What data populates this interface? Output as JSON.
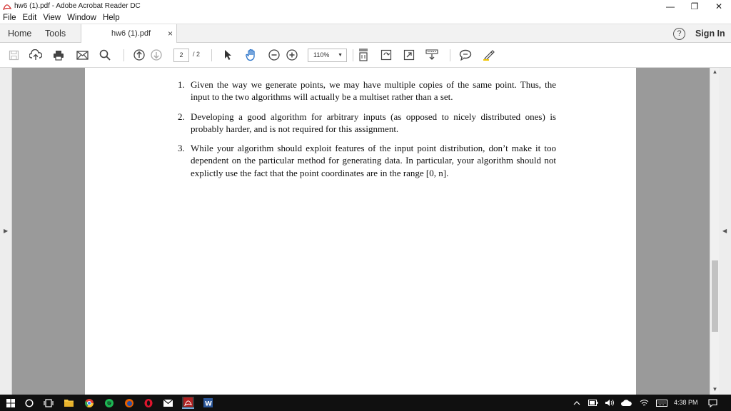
{
  "window": {
    "title": "hw6 (1).pdf - Adobe Acrobat Reader DC",
    "minimize": "—",
    "restore": "❐",
    "close": "✕"
  },
  "menu": [
    "File",
    "Edit",
    "View",
    "Window",
    "Help"
  ],
  "tabs": {
    "home": "Home",
    "tools": "Tools",
    "document": "hw6 (1).pdf",
    "close": "×",
    "help": "?",
    "sign_in": "Sign In"
  },
  "toolbar": {
    "current_page": "2",
    "total_pages": "/ 2",
    "zoom": "110%"
  },
  "document": {
    "items": [
      {
        "number": "1.",
        "text": "Given the way we generate points, we may have multiple copies of the same point. Thus, the input to the two algorithms will actually be a multiset rather than a set."
      },
      {
        "number": "2.",
        "text": "Developing a good algorithm for arbitrary inputs (as opposed to nicely distributed ones) is probably harder, and is not required for this assignment."
      },
      {
        "number": "3.",
        "text": "While your algorithm should exploit features of the input point distribution, don’t make it too dependent on the particular method for generating data. In particular, your algorithm should not explictly use the fact that the point coordinates are in the range [0, n]."
      }
    ]
  },
  "taskbar": {
    "time": "4:38 PM"
  },
  "colors": {
    "acrobat_red": "#d32f2f",
    "taskbar_bg": "#101010",
    "doc_gray": "#9a9a9a"
  }
}
